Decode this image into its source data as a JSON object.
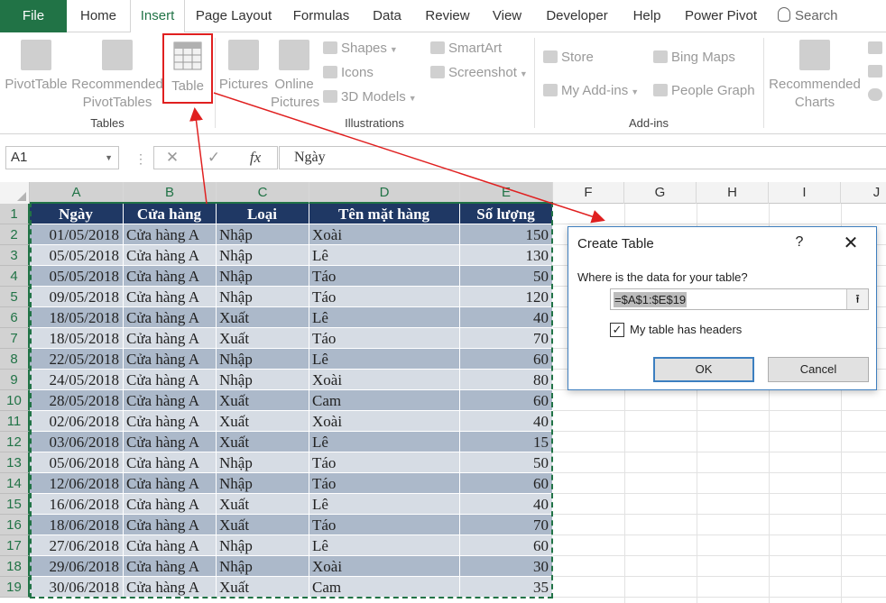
{
  "tabs": {
    "file": "File",
    "home": "Home",
    "insert": "Insert",
    "page_layout": "Page Layout",
    "formulas": "Formulas",
    "data": "Data",
    "review": "Review",
    "view": "View",
    "developer": "Developer",
    "help": "Help",
    "power_pivot": "Power Pivot",
    "search": "Search"
  },
  "ribbon": {
    "tables": {
      "pivottable": "PivotTable",
      "recommended_1": "Recommended",
      "recommended_2": "PivotTables",
      "table": "Table",
      "group": "Tables"
    },
    "illustrations": {
      "pictures": "Pictures",
      "online_1": "Online",
      "online_2": "Pictures",
      "shapes": "Shapes",
      "icons": "Icons",
      "models": "3D Models",
      "smartart": "SmartArt",
      "screenshot": "Screenshot",
      "group": "Illustrations"
    },
    "addins": {
      "store": "Store",
      "my_addins": "My Add-ins",
      "bing_maps": "Bing Maps",
      "people_graph": "People Graph",
      "group": "Add-ins"
    },
    "charts": {
      "rec_1": "Recommended",
      "rec_2": "Charts"
    }
  },
  "formula_bar": {
    "name_box": "A1",
    "content": "Ngày"
  },
  "columns": [
    "A",
    "B",
    "C",
    "D",
    "E",
    "F",
    "G",
    "H",
    "I",
    "J"
  ],
  "headers": [
    "Ngày",
    "Cửa hàng",
    "Loại",
    "Tên mặt hàng",
    "Số lượng"
  ],
  "rows": [
    [
      "01/05/2018",
      "Cửa hàng A",
      "Nhập",
      "Xoài",
      "150"
    ],
    [
      "05/05/2018",
      "Cửa hàng A",
      "Nhập",
      "Lê",
      "130"
    ],
    [
      "05/05/2018",
      "Cửa hàng A",
      "Nhập",
      "Táo",
      "50"
    ],
    [
      "09/05/2018",
      "Cửa hàng A",
      "Nhập",
      "Táo",
      "120"
    ],
    [
      "18/05/2018",
      "Cửa hàng A",
      "Xuất",
      "Lê",
      "40"
    ],
    [
      "18/05/2018",
      "Cửa hàng A",
      "Xuất",
      "Táo",
      "70"
    ],
    [
      "22/05/2018",
      "Cửa hàng A",
      "Nhập",
      "Lê",
      "60"
    ],
    [
      "24/05/2018",
      "Cửa hàng A",
      "Nhập",
      "Xoài",
      "80"
    ],
    [
      "28/05/2018",
      "Cửa hàng A",
      "Xuất",
      "Cam",
      "60"
    ],
    [
      "02/06/2018",
      "Cửa hàng A",
      "Xuất",
      "Xoài",
      "40"
    ],
    [
      "03/06/2018",
      "Cửa hàng A",
      "Xuất",
      "Lê",
      "15"
    ],
    [
      "05/06/2018",
      "Cửa hàng A",
      "Nhập",
      "Táo",
      "50"
    ],
    [
      "12/06/2018",
      "Cửa hàng A",
      "Nhập",
      "Táo",
      "60"
    ],
    [
      "16/06/2018",
      "Cửa hàng A",
      "Xuất",
      "Lê",
      "40"
    ],
    [
      "18/06/2018",
      "Cửa hàng A",
      "Xuất",
      "Táo",
      "70"
    ],
    [
      "27/06/2018",
      "Cửa hàng A",
      "Nhập",
      "Lê",
      "60"
    ],
    [
      "29/06/2018",
      "Cửa hàng A",
      "Nhập",
      "Xoài",
      "30"
    ],
    [
      "30/06/2018",
      "Cửa hàng A",
      "Xuất",
      "Cam",
      "35"
    ]
  ],
  "row_numbers": [
    "1",
    "2",
    "3",
    "4",
    "5",
    "6",
    "7",
    "8",
    "9",
    "10",
    "11",
    "12",
    "13",
    "14",
    "15",
    "16",
    "17",
    "18",
    "19"
  ],
  "dialog": {
    "title": "Create Table",
    "help": "?",
    "close": "✕",
    "question": "Where is the data for your table?",
    "range": "=$A$1:$E$19",
    "headers_label": "My table has headers",
    "headers_checked": true,
    "ok": "OK",
    "cancel": "Cancel"
  },
  "colors": {
    "excel_green": "#217346",
    "header_fill": "#1f3864",
    "band_dark": "#acb9ca",
    "band_light": "#d6dce4",
    "annotation_red": "#e02020"
  }
}
